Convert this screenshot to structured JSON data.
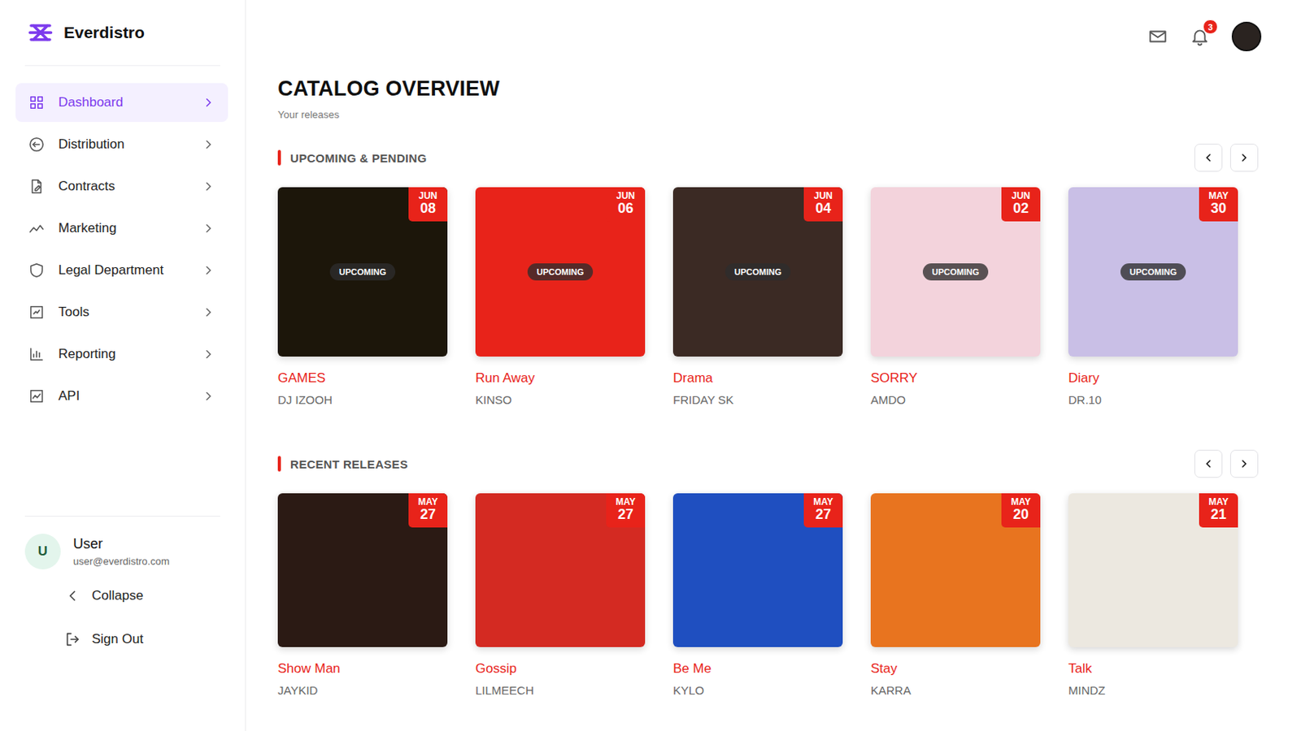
{
  "brand": {
    "name": "Everdistro"
  },
  "sidebar": {
    "items": [
      {
        "label": "Dashboard",
        "selected": true
      },
      {
        "label": "Distribution",
        "selected": false
      },
      {
        "label": "Contracts",
        "selected": false
      },
      {
        "label": "Marketing",
        "selected": false
      },
      {
        "label": "Legal Department",
        "selected": false
      },
      {
        "label": "Tools",
        "selected": false
      },
      {
        "label": "Reporting",
        "selected": false
      },
      {
        "label": "API",
        "selected": false
      }
    ],
    "user": {
      "avatar_letter": "U",
      "name": "User",
      "email": "user@everdistro.com"
    },
    "actions": [
      {
        "label": "Collapse",
        "kind": "collapse"
      },
      {
        "label": "Sign Out",
        "kind": "signout"
      }
    ]
  },
  "topbar": {
    "notifications_count": "3"
  },
  "page": {
    "title": "CATALOG OVERVIEW",
    "subtitle": "Your releases"
  },
  "sections": [
    {
      "title": "UPCOMING & PENDING",
      "releases": [
        {
          "title": "GAMES",
          "artist": "DJ IZOOH",
          "month": "JUN",
          "day": "08",
          "status": "UPCOMING",
          "color": "#1c160a"
        },
        {
          "title": "Run Away",
          "artist": "KINSO",
          "month": "JUN",
          "day": "06",
          "status": "UPCOMING",
          "color": "#e8231a"
        },
        {
          "title": "Drama",
          "artist": "FRIDAY SK",
          "month": "JUN",
          "day": "04",
          "status": "UPCOMING",
          "color": "#3b2a24"
        },
        {
          "title": "SORRY",
          "artist": "AMDO",
          "month": "JUN",
          "day": "02",
          "status": "UPCOMING",
          "color": "#f3d3dc"
        },
        {
          "title": "Diary",
          "artist": "DR.10",
          "month": "MAY",
          "day": "30",
          "status": "UPCOMING",
          "color": "#c9bfe6"
        }
      ]
    },
    {
      "title": "RECENT RELEASES",
      "releases": [
        {
          "title": "Show Man",
          "artist": "JAYKID",
          "month": "MAY",
          "day": "27",
          "status": "",
          "color": "#2b1a14"
        },
        {
          "title": "Gossip",
          "artist": "LILMEECH",
          "month": "MAY",
          "day": "27",
          "status": "",
          "color": "#d42a22"
        },
        {
          "title": "Be Me",
          "artist": "KYLO",
          "month": "MAY",
          "day": "27",
          "status": "",
          "color": "#1f4fc0"
        },
        {
          "title": "Stay",
          "artist": "KARRA",
          "month": "MAY",
          "day": "20",
          "status": "",
          "color": "#e8741f"
        },
        {
          "title": "Talk",
          "artist": "MINDZ",
          "month": "MAY",
          "day": "21",
          "status": "",
          "color": "#ece8e0"
        }
      ]
    }
  ]
}
